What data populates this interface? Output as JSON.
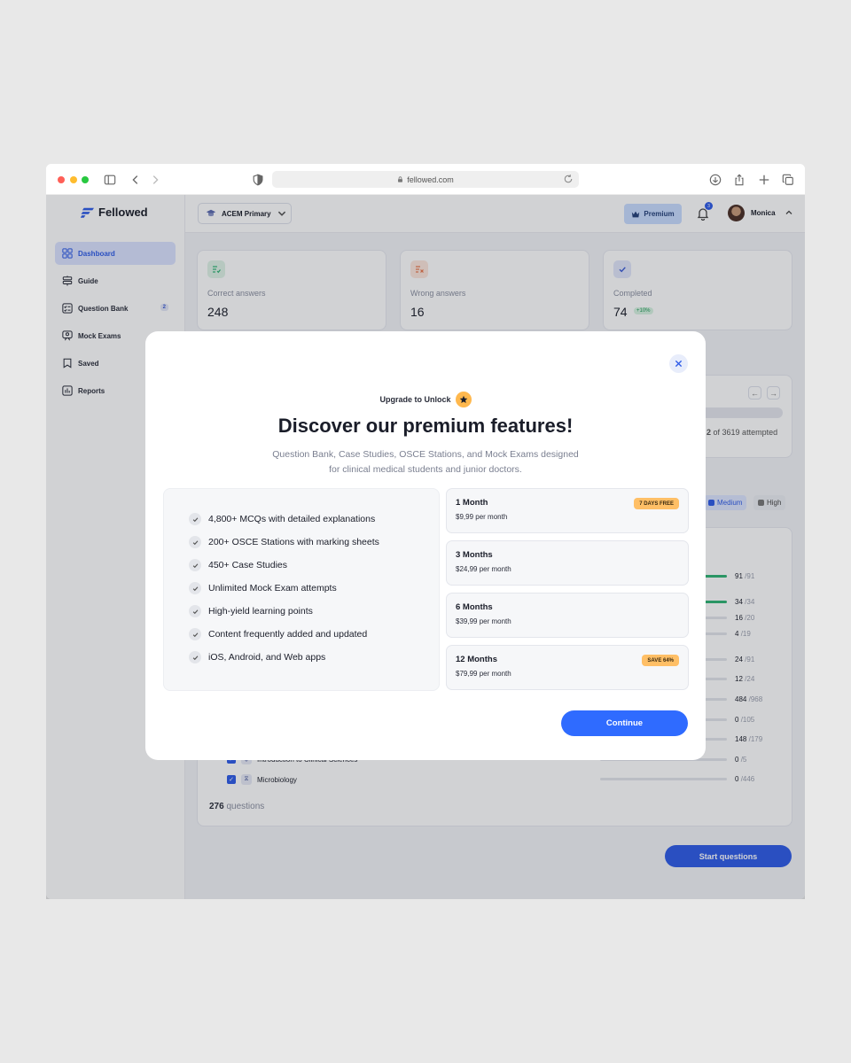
{
  "browser": {
    "url": "fellowed.com",
    "traffic_lights": [
      "#ff5f57",
      "#febc2e",
      "#28c840"
    ]
  },
  "app": {
    "brand": "Fellowed",
    "accent": "#2f5ce8",
    "sidebar": {
      "items": [
        {
          "label": "Dashboard",
          "icon": "grid-icon",
          "active": true
        },
        {
          "label": "Guide",
          "icon": "signpost-icon"
        },
        {
          "label": "Question Bank",
          "icon": "checklist-icon",
          "badge": "2"
        },
        {
          "label": "Mock Exams",
          "icon": "exam-icon"
        },
        {
          "label": "Saved",
          "icon": "bookmark-icon"
        },
        {
          "label": "Reports",
          "icon": "chart-icon"
        }
      ]
    },
    "topbar": {
      "course": "ACEM Primary",
      "premium_label": "Premium",
      "notifications": "3",
      "user": "Monica"
    },
    "stats": [
      {
        "label": "Correct answers",
        "value": "248"
      },
      {
        "label": "Wrong answers",
        "value": "16"
      },
      {
        "label": "Completed",
        "value": "74",
        "delta": "+10%"
      }
    ],
    "progress": {
      "attempted_count": "2",
      "attempted_text": "of 3619 attempted"
    },
    "filters": [
      "Medium",
      "High"
    ],
    "subject_bars": [
      {
        "done": "91",
        "total": "/91",
        "fraction": 1.0
      },
      {
        "done": "34",
        "total": "/34",
        "fraction": 1.0
      },
      {
        "done": "16",
        "total": "/20",
        "fraction": 0.8
      },
      {
        "done": "4",
        "total": "/19",
        "fraction": 0.21
      },
      {
        "done": "24",
        "total": "/91",
        "fraction": 0.26
      },
      {
        "done": "12",
        "total": "/24",
        "fraction": 0.5
      },
      {
        "done": "484",
        "total": "/968",
        "fraction": 0.5
      },
      {
        "done": "0",
        "total": "/105",
        "fraction": 0
      },
      {
        "done": "148",
        "total": "/179",
        "fraction": 0.83
      },
      {
        "done": "0",
        "total": "/5",
        "fraction": 0
      },
      {
        "done": "0",
        "total": "/446",
        "fraction": 0
      }
    ],
    "topics": [
      {
        "label": "Introduction to Clinical Sciences"
      },
      {
        "label": "Microbiology"
      }
    ],
    "question_count": "276",
    "question_count_suffix": "questions",
    "start_label": "Start questions"
  },
  "modal": {
    "eyebrow": "Upgrade to Unlock",
    "title": "Discover our premium features!",
    "subtitle": "Question Bank, Case Studies, OSCE Stations, and Mock Exams designed for clinical medical students and junior doctors.",
    "features": [
      "4,800+ MCQs with detailed explanations",
      "200+ OSCE Stations with marking sheets",
      "450+ Case Studies",
      "Unlimited Mock Exam attempts",
      "High-yield learning points",
      "Content frequently added and updated",
      "iOS, Android, and Web apps"
    ],
    "plans": [
      {
        "name": "1 Month",
        "price": "$9,99 per month",
        "tag": "7 DAYS FREE"
      },
      {
        "name": "3 Months",
        "price": "$24,99 per month",
        "tag": ""
      },
      {
        "name": "6 Months",
        "price": "$39,99 per month",
        "tag": ""
      },
      {
        "name": "12 Months",
        "price": "$79,99 per month",
        "tag": "SAVE 64%"
      }
    ],
    "continue_label": "Continue",
    "tag_color": "#ffbf66",
    "button_color": "#2f6bff"
  }
}
